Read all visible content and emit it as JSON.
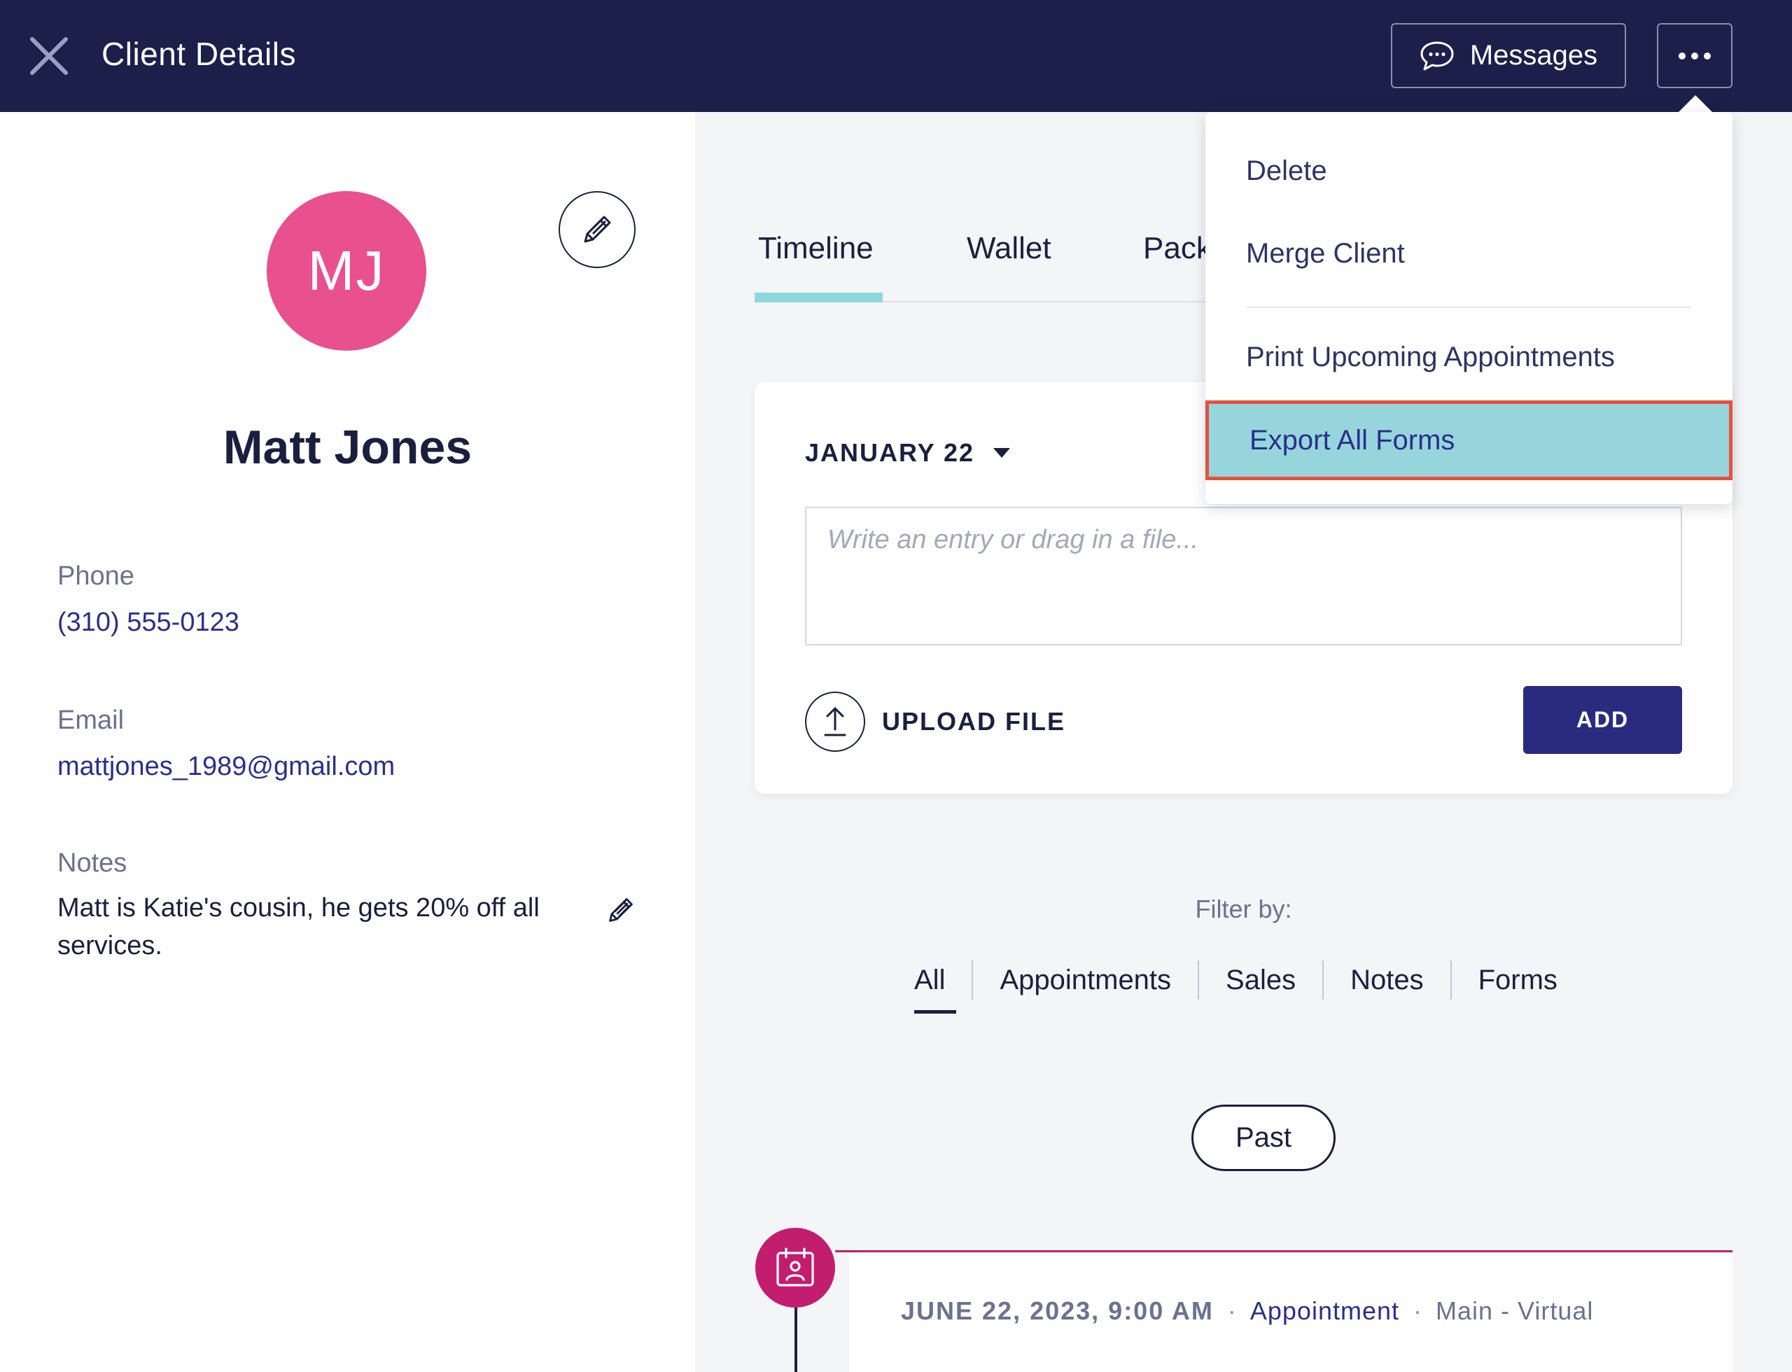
{
  "header": {
    "title": "Client Details",
    "messages_label": "Messages"
  },
  "client": {
    "initials": "MJ",
    "name": "Matt Jones",
    "phone_label": "Phone",
    "phone": "(310) 555-0123",
    "email_label": "Email",
    "email": "mattjones_1989@gmail.com",
    "notes_label": "Notes",
    "notes": "Matt is Katie's cousin, he gets 20% off all services."
  },
  "tabs": [
    {
      "label": "Timeline",
      "active": true
    },
    {
      "label": "Wallet"
    },
    {
      "label": "Pack"
    }
  ],
  "entry": {
    "date": "JANUARY 22",
    "placeholder": "Write an entry or drag in a file...",
    "upload_label": "UPLOAD FILE",
    "add_label": "ADD"
  },
  "filter": {
    "label": "Filter by:",
    "options": [
      "All",
      "Appointments",
      "Sales",
      "Notes",
      "Forms"
    ]
  },
  "past_label": "Past",
  "timeline_item": {
    "date": "JUNE 22, 2023, 9:00 AM",
    "separator": "·",
    "type": "Appointment",
    "location": "Main - Virtual"
  },
  "menu": {
    "items": [
      "Delete",
      "Merge Client",
      "Print Upcoming Appointments"
    ],
    "highlighted": "Export All Forms"
  },
  "colors": {
    "header_bg": "#1b1f4a",
    "avatar_bg": "#e8508f",
    "accent_teal": "#97d5dc",
    "primary_button": "#2a2b7f",
    "highlight_border": "#e6503c",
    "timeline_accent": "#c21d6f"
  },
  "icons": {
    "close": "close-icon",
    "messages": "chat-bubble-icon",
    "more": "more-horizontal-icon",
    "edit": "pencil-icon",
    "upload": "upload-icon",
    "caret": "caret-down-icon",
    "appointment": "calendar-contact-icon"
  }
}
